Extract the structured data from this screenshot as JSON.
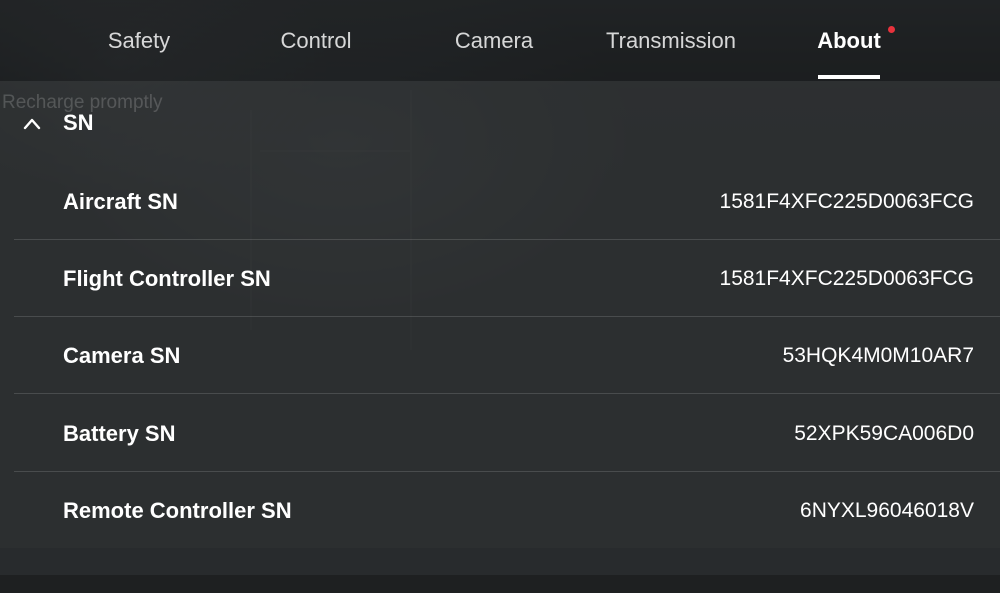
{
  "tabs": [
    {
      "label": "Safety"
    },
    {
      "label": "Control"
    },
    {
      "label": "Camera"
    },
    {
      "label": "Transmission"
    },
    {
      "label": "About",
      "active": true,
      "has_notification": true
    }
  ],
  "background_hint": "Recharge promptly",
  "section": {
    "title": "SN",
    "expanded": true,
    "icon": "chevron-up-icon"
  },
  "rows": [
    {
      "label": "Aircraft SN",
      "value": "1581F4XFC225D0063FCG"
    },
    {
      "label": "Flight Controller SN",
      "value": "1581F4XFC225D0063FCG"
    },
    {
      "label": "Camera SN",
      "value": "53HQK4M0M10AR7"
    },
    {
      "label": "Battery SN",
      "value": "52XPK59CA006D0"
    },
    {
      "label": "Remote Controller SN",
      "value": "6NYXL96046018V"
    }
  ],
  "colors": {
    "accent_notification": "#e8323c",
    "active_underline": "#ffffff"
  }
}
